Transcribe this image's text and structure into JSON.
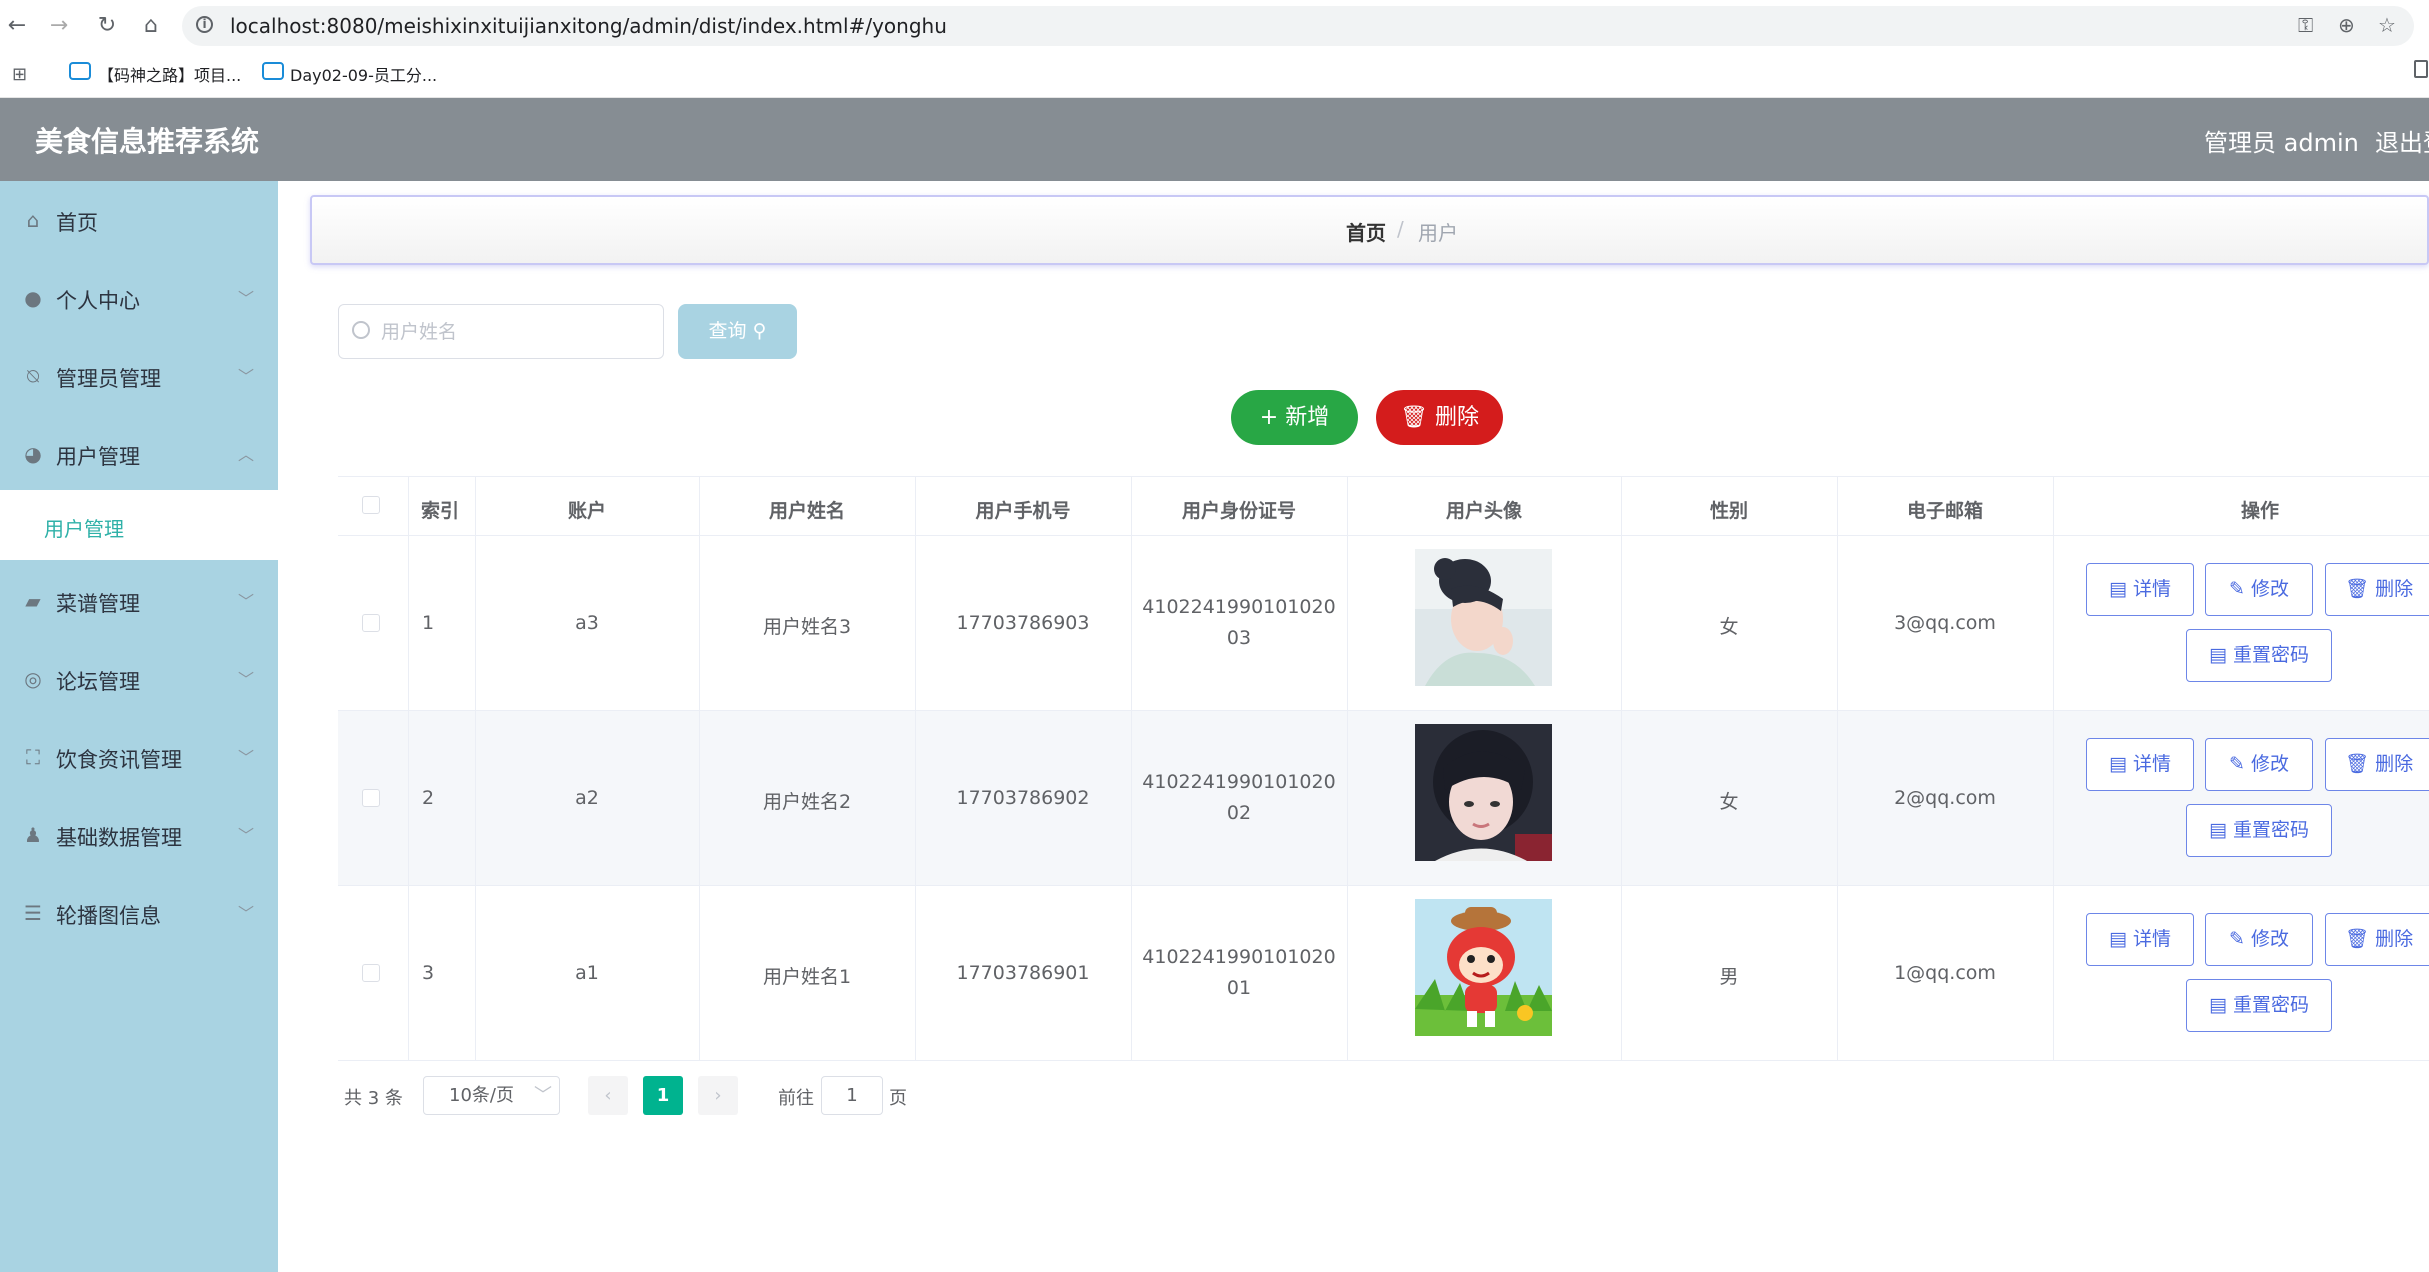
{
  "browser": {
    "url": "localhost:8080/meishixinxituijianxitong/admin/dist/index.html#/yonghu",
    "bookmarks": [
      "【码神之路】项目...",
      "Day02-09-员工分..."
    ]
  },
  "header": {
    "title": "美食信息推荐系统",
    "admin": "管理员 admin",
    "logout": "退出登"
  },
  "sidebar": {
    "items": [
      {
        "label": "首页",
        "icon": "home-icon"
      },
      {
        "label": "个人中心",
        "icon": "user-icon"
      },
      {
        "label": "管理员管理",
        "icon": "bell-off-icon"
      },
      {
        "label": "用户管理",
        "icon": "pin-icon"
      },
      {
        "label": "菜谱管理",
        "icon": "ticket-icon"
      },
      {
        "label": "论坛管理",
        "icon": "compass-icon"
      },
      {
        "label": "饮食资讯管理",
        "icon": "frame-icon"
      },
      {
        "label": "基础数据管理",
        "icon": "stamp-icon"
      },
      {
        "label": "轮播图信息",
        "icon": "list-icon"
      }
    ],
    "submenu_label": "用户管理"
  },
  "breadcrumb": {
    "home": "首页",
    "separator": "/",
    "current": "用户"
  },
  "search": {
    "placeholder": "用户姓名",
    "query_label": "查询"
  },
  "actions": {
    "add": "新增",
    "delete": "删除"
  },
  "table": {
    "headers": [
      "索引",
      "账户",
      "用户姓名",
      "用户手机号",
      "用户身份证号",
      "用户头像",
      "性别",
      "电子邮箱",
      "操作"
    ],
    "rows": [
      {
        "index": "1",
        "account": "a3",
        "name": "用户姓名3",
        "phone": "17703786903",
        "id_line1": "4102241990101020",
        "id_line2": "03",
        "gender": "女",
        "email": "3@qq.com"
      },
      {
        "index": "2",
        "account": "a2",
        "name": "用户姓名2",
        "phone": "17703786902",
        "id_line1": "4102241990101020",
        "id_line2": "02",
        "gender": "女",
        "email": "2@qq.com"
      },
      {
        "index": "3",
        "account": "a1",
        "name": "用户姓名1",
        "phone": "17703786901",
        "id_line1": "4102241990101020",
        "id_line2": "01",
        "gender": "男",
        "email": "1@qq.com"
      }
    ],
    "ops": {
      "detail": "详情",
      "edit": "修改",
      "delete": "删除",
      "reset": "重置密码"
    }
  },
  "pagination": {
    "total": "共 3 条",
    "page_size": "10条/页",
    "current": "1",
    "goto": "前往",
    "goto_value": "1",
    "page_suffix": "页"
  },
  "colors": {
    "header": "#868d93",
    "sidebar": "#a9d3e2",
    "accent": "#00b38f",
    "add": "#28a745",
    "delete": "#d41c1c",
    "op": "#4a6ae0"
  }
}
